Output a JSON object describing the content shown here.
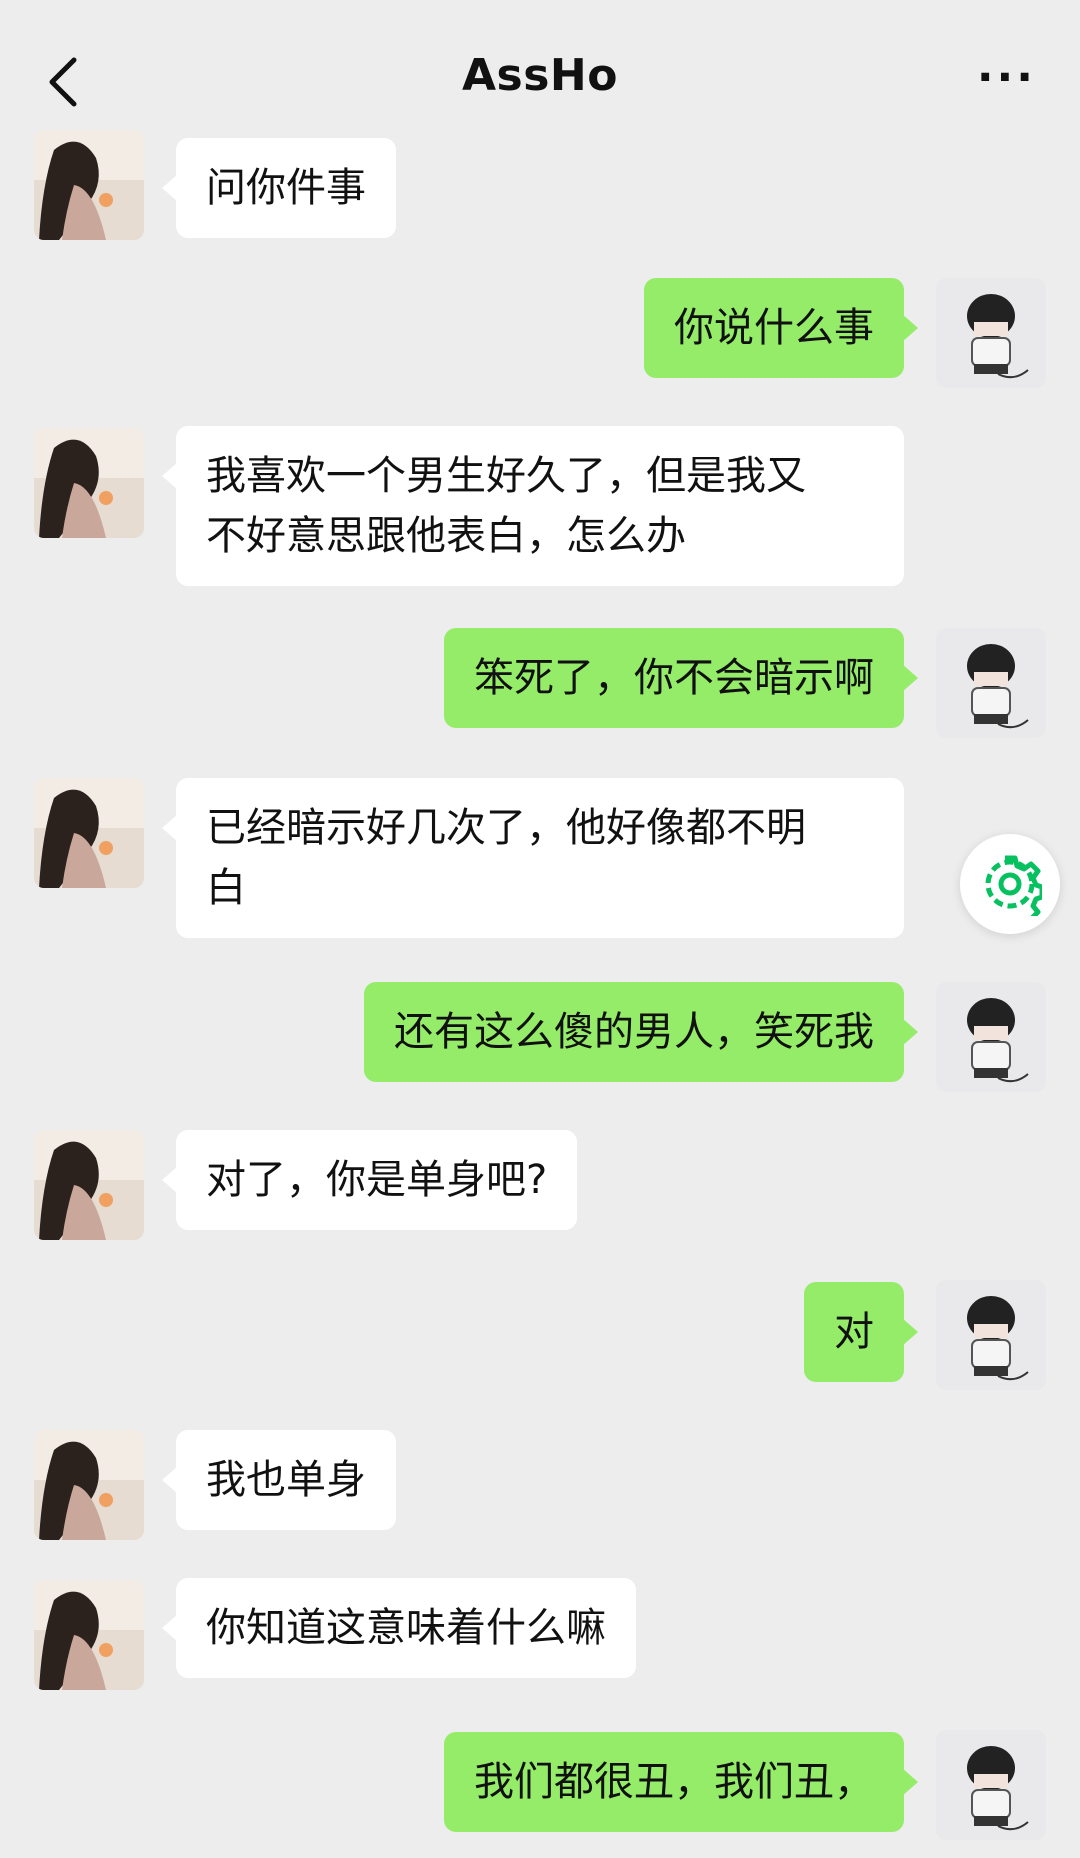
{
  "header": {
    "title": "AssHo",
    "back_icon": "chevron-left-icon",
    "more_label": "···"
  },
  "messages": [
    {
      "side": "in",
      "text": "问你件事"
    },
    {
      "side": "out",
      "text": "你说什么事"
    },
    {
      "side": "in",
      "text": "我喜欢一个男生好久了，但是我又\n不好意思跟他表白，怎么办"
    },
    {
      "side": "out",
      "text": "笨死了，你不会暗示啊"
    },
    {
      "side": "in",
      "text": "已经暗示好几次了，他好像都不明\n白"
    },
    {
      "side": "out",
      "text": "还有这么傻的男人，笑死我"
    },
    {
      "side": "in",
      "text": "对了，你是单身吧?"
    },
    {
      "side": "out",
      "text": "对"
    },
    {
      "side": "in",
      "text": "我也单身"
    },
    {
      "side": "in",
      "text": "你知道这意味着什么嘛"
    },
    {
      "side": "out",
      "text": "我们都很丑，我们丑，"
    }
  ],
  "floating": {
    "icon": "gear-icon"
  },
  "colors": {
    "background": "#ededed",
    "incoming": "#ffffff",
    "outgoing": "#95ec69",
    "accent": "#07c160"
  }
}
